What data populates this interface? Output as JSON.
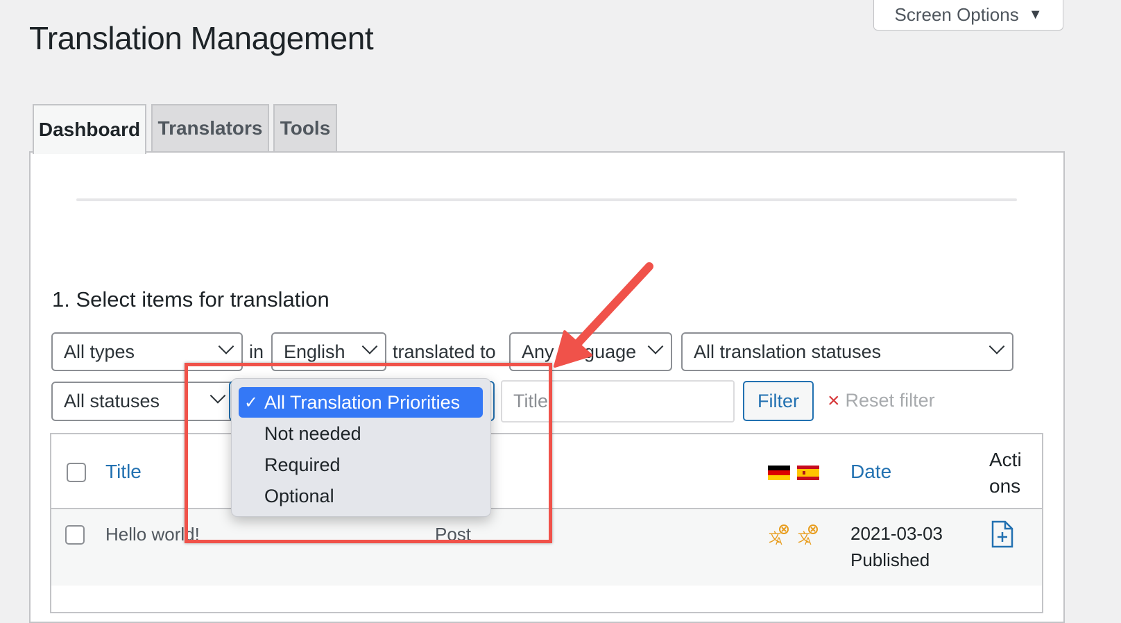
{
  "header": {
    "title": "Translation Management",
    "screen_options": "Screen Options",
    "screen_options_icon": "triangle-down-icon"
  },
  "tabs": [
    {
      "label": "Dashboard",
      "active": true
    },
    {
      "label": "Translators",
      "active": false
    },
    {
      "label": "Tools",
      "active": false
    }
  ],
  "section": {
    "heading": "1. Select items for translation"
  },
  "filters": {
    "type_select": "All types",
    "in_label": "in",
    "source_language": "English",
    "translated_to_label": "translated to",
    "target_language": "Any language",
    "translation_status": "All translation statuses",
    "post_status": "All statuses",
    "title_placeholder": "Title",
    "filter_button": "Filter",
    "reset_filter": "Reset filter"
  },
  "priority_dropdown": {
    "options": [
      {
        "label": "All Translation Priorities",
        "selected": true
      },
      {
        "label": "Not needed",
        "selected": false
      },
      {
        "label": "Required",
        "selected": false
      },
      {
        "label": "Optional",
        "selected": false
      }
    ],
    "check_glyph": "✓"
  },
  "table": {
    "columns": {
      "title": "Title",
      "date": "Date",
      "actions": "Actions"
    },
    "flags": [
      "German",
      "Spanish"
    ],
    "rows": [
      {
        "title": "Hello world!",
        "type": "Post",
        "date": "2021-03-03",
        "status": "Published"
      }
    ]
  },
  "colors": {
    "accent": "#2271b1",
    "annotation": "#f0524a",
    "dropdown_selected": "#3478f6",
    "translate_icon": "#e89c1c"
  }
}
